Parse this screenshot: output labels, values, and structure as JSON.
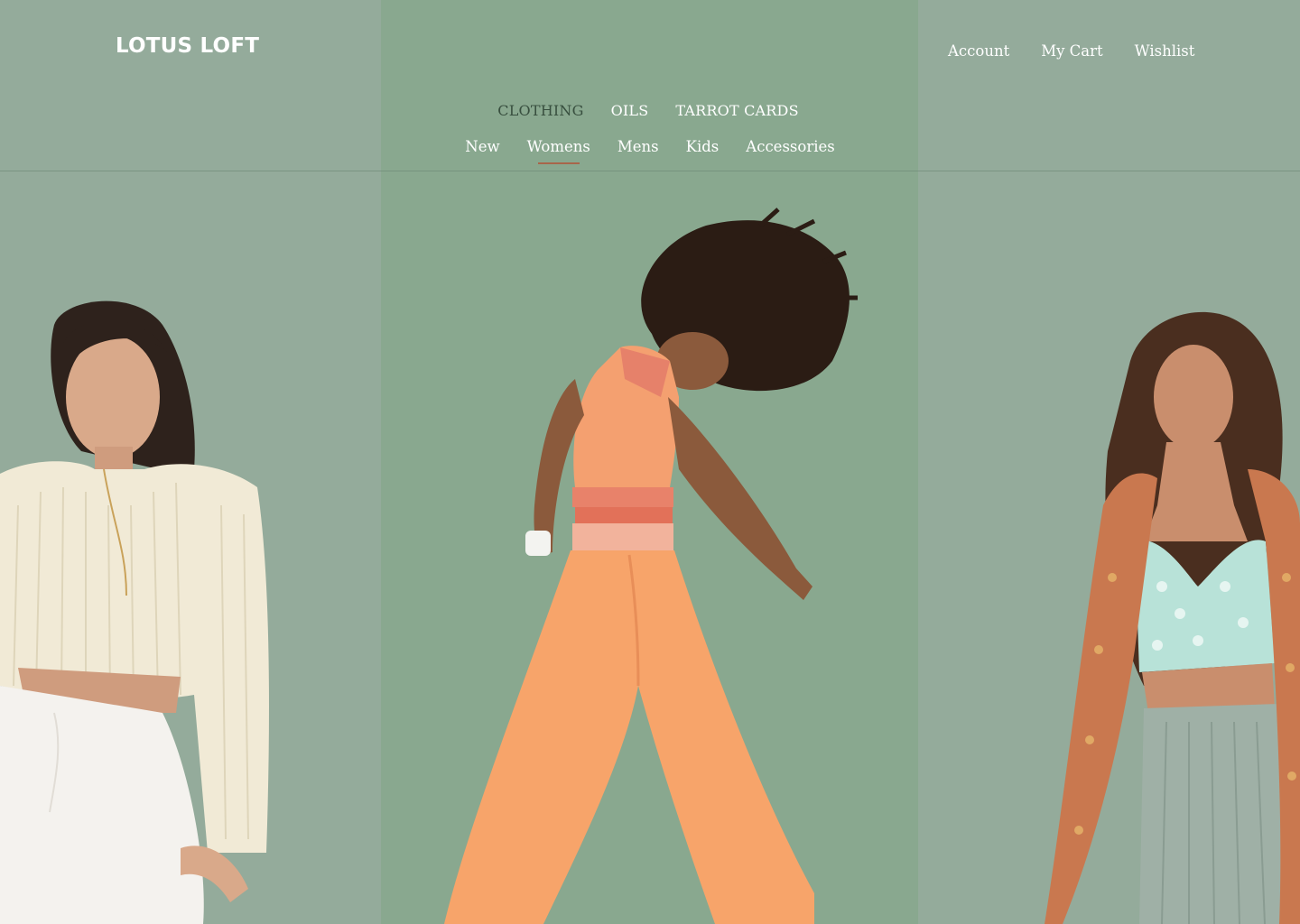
{
  "brand": {
    "name": "LOTUS LOFT"
  },
  "account_nav": {
    "items": [
      {
        "label": "Account"
      },
      {
        "label": "My Cart"
      },
      {
        "label": "Wishlist"
      }
    ]
  },
  "category_nav": {
    "active": "CLOTHING",
    "items": [
      {
        "label": "CLOTHING"
      },
      {
        "label": "OILS"
      },
      {
        "label": "TARROT CARDS"
      }
    ]
  },
  "sub_nav": {
    "active": "Womens",
    "items": [
      {
        "label": "New"
      },
      {
        "label": "Womens"
      },
      {
        "label": "Mens"
      },
      {
        "label": "Kids"
      },
      {
        "label": "Accessories"
      }
    ]
  },
  "panels": [
    {
      "image": "model in cream crochet cropped sweater and white pants"
    },
    {
      "image": "model in orange halter top and wide-leg pants"
    },
    {
      "image": "model in printed kimono and lace bralette"
    }
  ],
  "colors": {
    "side_panel_bg": "#94ab9b",
    "center_panel_bg": "#89a88f",
    "text_light": "#ffffff",
    "text_active": "#384f3f",
    "active_underline": "#a8664a"
  }
}
